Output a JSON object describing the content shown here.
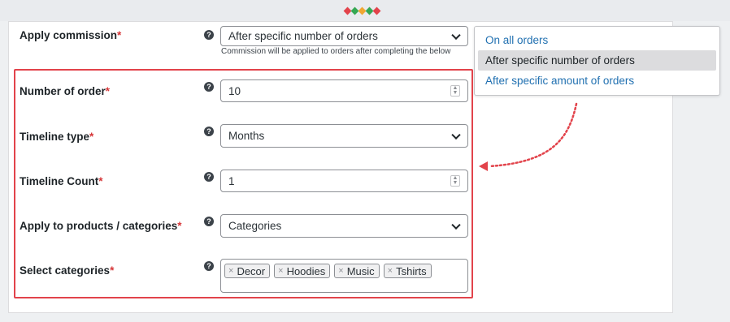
{
  "apply_commission": {
    "label": "Apply commission",
    "required": "*",
    "help": "?",
    "value": "After specific number of orders",
    "description": "Commission will be applied to orders after completing the below"
  },
  "dropdown": {
    "options": [
      "On all orders",
      "After specific number of orders",
      "After specific amount of orders"
    ]
  },
  "number_of_order": {
    "label": "Number of order",
    "required": "*",
    "help": "?",
    "value": "10"
  },
  "timeline_type": {
    "label": "Timeline type",
    "required": "*",
    "help": "?",
    "value": "Months"
  },
  "timeline_count": {
    "label": "Timeline Count",
    "required": "*",
    "help": "?",
    "value": "1"
  },
  "apply_to": {
    "label": "Apply to products / categories",
    "required": "*",
    "help": "?",
    "value": "Categories"
  },
  "select_categories": {
    "label": "Select categories",
    "required": "*",
    "help": "?",
    "remove_glyph": "×",
    "tags": [
      "Decor",
      "Hoodies",
      "Music",
      "Tshirts"
    ]
  },
  "colors": {
    "highlight": "#e2434b",
    "link": "#2271b1",
    "required": "#d63638"
  }
}
